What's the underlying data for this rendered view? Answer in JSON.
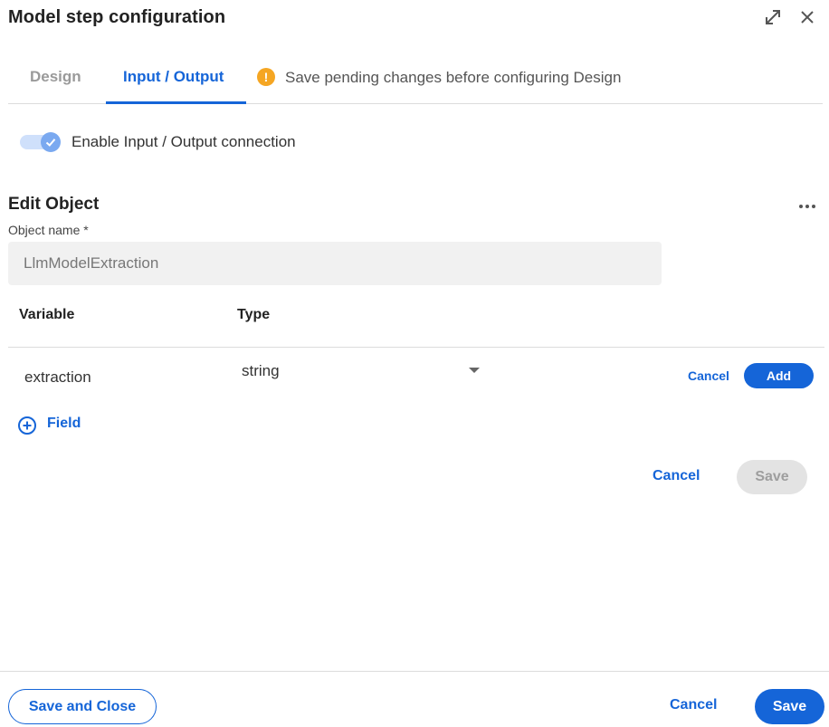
{
  "dialog": {
    "title": "Model step configuration",
    "icons": {
      "expand": "expand-icon",
      "close": "close-icon"
    }
  },
  "tabs": [
    {
      "label": "Design",
      "active": false
    },
    {
      "label": "Input / Output",
      "active": true
    }
  ],
  "warning": {
    "icon": "warning-icon",
    "text": "Save pending changes before configuring Design",
    "color": "#f5a623"
  },
  "toggle": {
    "label": "Enable Input / Output connection",
    "checked": true
  },
  "edit_object": {
    "title": "Edit Object",
    "more_icon": "more-horizontal-icon",
    "object_name_label": "Object name *",
    "object_name_value": "LlmModelExtraction"
  },
  "table": {
    "headers": {
      "variable": "Variable",
      "type": "Type"
    },
    "rows": [
      {
        "variable": "extraction",
        "type": "string",
        "cancel_label": "Cancel",
        "add_label": "Add"
      }
    ],
    "add_field_label": "Field"
  },
  "object_actions": {
    "cancel_label": "Cancel",
    "save_label": "Save"
  },
  "footer": {
    "save_close_label": "Save and Close",
    "cancel_label": "Cancel",
    "save_label": "Save"
  },
  "colors": {
    "accent": "#1565d8",
    "disabled": "#e3e3e3"
  }
}
